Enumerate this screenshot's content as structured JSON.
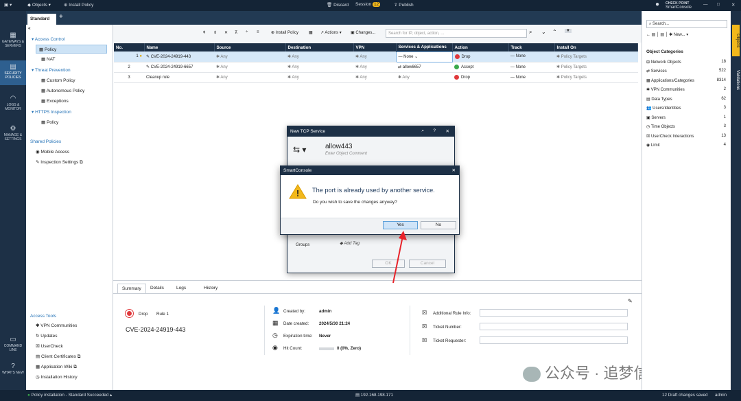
{
  "topbar": {
    "objects": "Objects",
    "install_policy": "Install Policy",
    "discard": "Discard",
    "session": "Session",
    "session_count": "12",
    "publish": "Publish",
    "brand_top": "CHECK POINT",
    "brand_bottom": "SmartConsole"
  },
  "tabs": {
    "active": "Standard"
  },
  "leftnav": {
    "gateways": "GATEWAYS & SERVERS",
    "security": "SECURITY POLICIES",
    "logs": "LOGS & MONITOR",
    "manage": "MANAGE & SETTINGS",
    "cmd": "COMMAND LINE",
    "whatsnew": "WHAT'S NEW"
  },
  "tree": {
    "access_control": "Access Control",
    "policy": "Policy",
    "nat": "NAT",
    "threat_prevention": "Threat Prevention",
    "custom_policy": "Custom Policy",
    "autonomous_policy": "Autonomous Policy",
    "exceptions": "Exceptions",
    "https_inspection": "HTTPS Inspection",
    "https_policy": "Policy",
    "shared_policies": "Shared Policies",
    "mobile_access": "Mobile Access",
    "inspection_settings": "Inspection Settings",
    "access_tools": "Access Tools",
    "vpn_communities": "VPN Communities",
    "updates": "Updates",
    "usercheck": "UserCheck",
    "client_certificates": "Client Certificates",
    "application_wiki": "Application Wiki",
    "installation_history": "Installation History"
  },
  "toolbar": {
    "install_policy": "Install Policy",
    "actions": "Actions",
    "changes": "Changes...",
    "search_placeholder": "Search for IP, object, action, ..."
  },
  "grid": {
    "headers": [
      "No.",
      "Name",
      "Source",
      "Destination",
      "VPN",
      "Services & Applications",
      "Action",
      "Track",
      "Install On"
    ],
    "rows": [
      {
        "no": "1",
        "name": "CVE-2024-24919-443",
        "source": "Any",
        "destination": "Any",
        "vpn": "Any",
        "services": "None",
        "action": "Drop",
        "track": "None",
        "install_on": "Policy Targets"
      },
      {
        "no": "2",
        "name": "CVE-2024-24919-6657",
        "source": "Any",
        "destination": "Any",
        "vpn": "Any",
        "services": "allow6657",
        "action": "Accept",
        "track": "None",
        "install_on": "Policy Targets"
      },
      {
        "no": "3",
        "name": "Cleanup rule",
        "source": "Any",
        "destination": "Any",
        "vpn": "Any",
        "services": "Any",
        "action": "Drop",
        "track": "None",
        "install_on": "Policy Targets"
      }
    ]
  },
  "bottom": {
    "tabs": [
      "Summary",
      "Details",
      "Logs",
      "History"
    ],
    "action": "Drop",
    "rule": "Rule 1",
    "rule_name": "CVE-2024-24919-443",
    "created_by_label": "Created by:",
    "created_by": "admin",
    "date_created_label": "Date created:",
    "date_created": "2024/5/30 21:24",
    "expiration_label": "Expiration time:",
    "expiration": "Never",
    "hit_count_label": "Hit Count:",
    "hit_count": "0 (0%, Zero)",
    "additional_info_label": "Additional Rule Info:",
    "ticket_number_label": "Ticket Number:",
    "ticket_requester_label": "Ticket Requester:"
  },
  "right_panel": {
    "search_placeholder": "Search...",
    "new": "New...",
    "categories_title": "Object Categories",
    "categories": [
      {
        "label": "Network Objects",
        "count": "18"
      },
      {
        "label": "Services",
        "count": "522"
      },
      {
        "label": "Applications/Categories",
        "count": "8314"
      },
      {
        "label": "VPN Communities",
        "count": "2"
      },
      {
        "label": "Data Types",
        "count": "62"
      },
      {
        "label": "Users/Identities",
        "count": "3"
      },
      {
        "label": "Servers",
        "count": "1"
      },
      {
        "label": "Time Objects",
        "count": "3"
      },
      {
        "label": "UserCheck Interactions",
        "count": "13"
      },
      {
        "label": "Limit",
        "count": "4"
      }
    ],
    "side_tabs": [
      "Objects",
      "Validations"
    ]
  },
  "dialog_tcp": {
    "title": "New TCP Service",
    "name": "allow443",
    "comment_placeholder": "Enter Object Comment",
    "groups_label": "Groups",
    "add_tag": "Add Tag",
    "ok": "OK",
    "cancel": "Cancel"
  },
  "dialog_confirm": {
    "title": "SmartConsole",
    "heading": "The port is already used by another service.",
    "message": "Do you wish to save the changes anyway?",
    "yes": "Yes",
    "no": "No"
  },
  "statusbar": {
    "install_status": "Policy installation - Standard Succeeded",
    "ip": "192.168.198.171",
    "drafts": "12 Draft changes saved",
    "user": "admin"
  },
  "watermark": "公众号 · 追梦信安",
  "colors": {
    "nav_dark": "#1d3046",
    "drop_red": "#e0393c",
    "accept_green": "#3aa94a",
    "arrow_red": "#e8232a",
    "warning_yellow": "#f2b81b"
  }
}
